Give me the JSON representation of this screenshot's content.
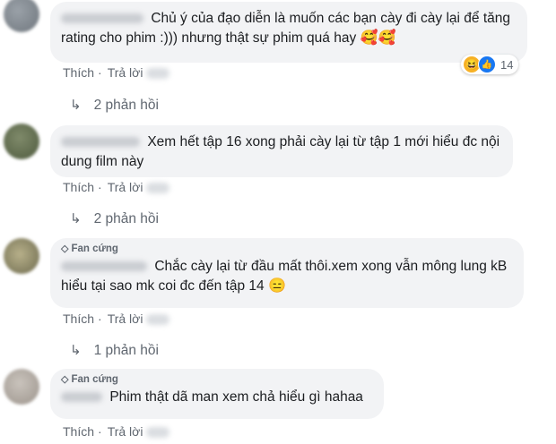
{
  "comments": [
    {
      "fan_badge": "",
      "text": "Chủ ý của đạo diễn là muốn các bạn cày đi cày lại để tăng rating cho phim :))) nhưng thật sự phim quá hay",
      "emoji": "🥰🥰",
      "like_label": "Thích",
      "reply_label": "Trả lời",
      "reaction_count": "14",
      "replies_label": "2 phản hồi"
    },
    {
      "fan_badge": "",
      "text": "Xem hết tập 16 xong phải cày lại từ tập 1 mới hiểu đc nội dung film này",
      "emoji": "",
      "like_label": "Thích",
      "reply_label": "Trả lời",
      "replies_label": "2 phản hồi"
    },
    {
      "fan_badge": "Fan cứng",
      "text": "Chắc cày lại từ đầu mất thôi.xem xong vẫn mông lung kB hiểu tại sao mk coi đc đến tập 14",
      "emoji": "😑",
      "like_label": "Thích",
      "reply_label": "Trả lời",
      "replies_label": "1 phản hồi"
    },
    {
      "fan_badge": "Fan cứng",
      "text": "Phim thật dã man xem chả hiểu gì hahaa",
      "emoji": "",
      "like_label": "Thích",
      "reply_label": "Trả lời"
    }
  ],
  "icons": {
    "reply_arrow": "reply-arrow-icon",
    "fan_badge": "diamond-icon",
    "reactions": [
      "haha-reaction-icon",
      "like-reaction-icon"
    ]
  },
  "colors": {
    "bubble": "#f2f3f5",
    "secondary_text": "#606770",
    "like_blue": "#1877f2",
    "haha_yellow": "#f7b125"
  }
}
